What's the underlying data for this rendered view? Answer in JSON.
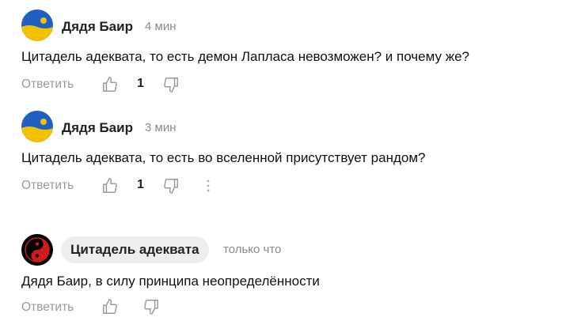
{
  "comments": [
    {
      "author": "Дядя Баир",
      "time": "4 мин",
      "text": "Цитадель адеквата, то есть демон Лапласа невозможен? и почему же?",
      "reply_label": "Ответить",
      "likes": "1"
    },
    {
      "author": "Дядя Баир",
      "time": "3 мин",
      "text": "Цитадель адеквата, то есть во вселенной присутствует рандом?",
      "reply_label": "Ответить",
      "likes": "1"
    },
    {
      "author": "Цитадель адеквата",
      "time": "только что",
      "text": "Дядя Баир, в силу принципа неопределённости",
      "reply_label": "Ответить"
    }
  ],
  "colors": {
    "muted_text": "#9a9a9a",
    "pill_bg": "#eeeeee",
    "avatar_blue": "#1f5fbf",
    "avatar_yellow": "#f2c200",
    "avatar_red": "#d11a1a"
  },
  "icons": [
    "thumbs-up-icon",
    "thumbs-down-icon",
    "more-vertical-icon"
  ]
}
